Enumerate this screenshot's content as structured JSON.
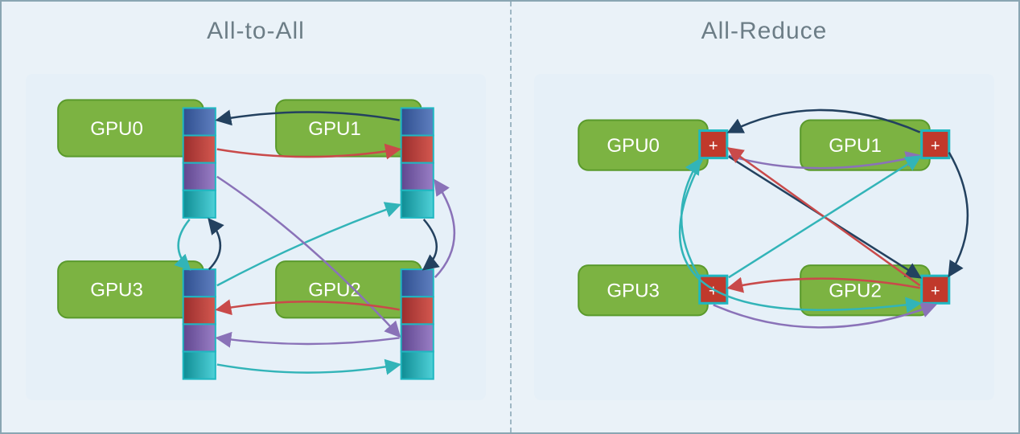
{
  "diagram": {
    "left_title": "All-to-All",
    "right_title": "All-Reduce",
    "gpus": {
      "g0": "GPU0",
      "g1": "GPU1",
      "g2": "GPU2",
      "g3": "GPU3"
    },
    "plus": "+",
    "colors": {
      "gpu_fill": "#7cb342",
      "gpu_stroke": "#5a9a2c",
      "seg_blue": "#3b5fa6",
      "seg_red": "#c0392b",
      "seg_purple": "#7b5aa6",
      "seg_teal": "#1fb7c1",
      "arrow_dark": "#23415f",
      "arrow_red": "#c94a4a",
      "arrow_purple": "#8a72b8",
      "arrow_teal": "#32b4b8"
    },
    "segment_order": [
      "seg_blue",
      "seg_red",
      "seg_purple",
      "seg_teal"
    ]
  }
}
